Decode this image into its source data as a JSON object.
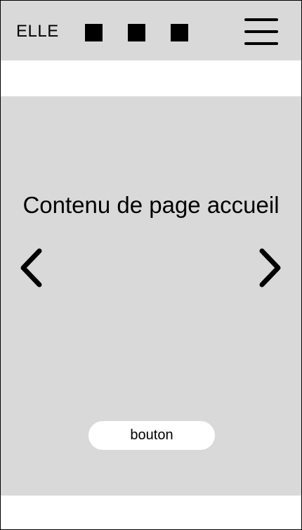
{
  "header": {
    "logo": "ELLE",
    "squares": [
      "square-icon",
      "square-icon",
      "square-icon"
    ],
    "menu_icon": "hamburger-menu-icon"
  },
  "main": {
    "title": "Contenu de page accueil",
    "prev_icon": "chevron-left-icon",
    "next_icon": "chevron-right-icon",
    "button_label": "bouton"
  },
  "colors": {
    "panel": "#d9d9d9",
    "background": "#ffffff",
    "ink": "#000000"
  }
}
